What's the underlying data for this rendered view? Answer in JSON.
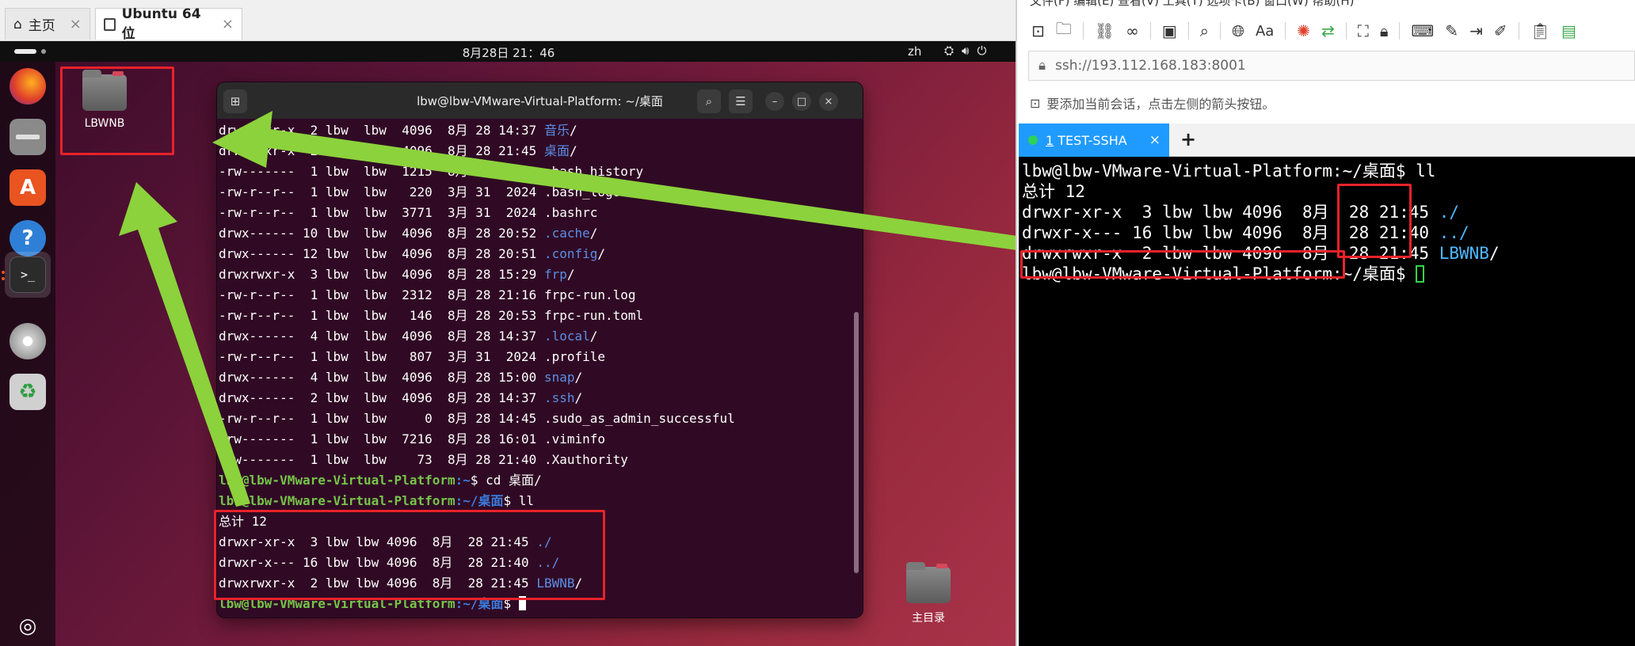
{
  "vmware": {
    "tabs": [
      {
        "label": "主页",
        "icon": "home-icon"
      },
      {
        "label": "Ubuntu 64 位",
        "icon": "vm-icon"
      }
    ]
  },
  "guest": {
    "clock": "8月28日  21：46",
    "lang": "zh",
    "desktop_icons": [
      {
        "label": "LBWNB"
      },
      {
        "label": "主目录"
      }
    ],
    "dock": [
      "firefox-icon",
      "files-icon",
      "app-center-icon",
      "help-icon",
      "terminal-icon",
      "dvd-icon",
      "trash-icon",
      "ubuntu-logo-icon"
    ]
  },
  "terminal": {
    "title": "lbw@lbw-VMware-Virtual-Platform: ~/桌面",
    "lines": [
      {
        "text": "drwxr-xr-x  2 lbw  lbw  4096  8月 28 14:37 ",
        "name": "音乐",
        "suffix": "/",
        "kind": "dir"
      },
      {
        "text": "drwxr-xr-x  2 lbw  lbw  4096  8月 28 21:45 ",
        "name": "桌面",
        "suffix": "/",
        "kind": "dir"
      },
      {
        "text": "-rw-------  1 lbw  lbw  1215  8月 28 20:51 ",
        "name": ".bash_history",
        "suffix": "",
        "kind": "file"
      },
      {
        "text": "-rw-r--r--  1 lbw  lbw   220  3月 31  2024 ",
        "name": ".bash_logout",
        "suffix": "",
        "kind": "file"
      },
      {
        "text": "-rw-r--r--  1 lbw  lbw  3771  3月 31  2024 ",
        "name": ".bashrc",
        "suffix": "",
        "kind": "file"
      },
      {
        "text": "drwx------ 10 lbw  lbw  4096  8月 28 20:52 ",
        "name": ".cache",
        "suffix": "/",
        "kind": "dir"
      },
      {
        "text": "drwx------ 12 lbw  lbw  4096  8月 28 20:51 ",
        "name": ".config",
        "suffix": "/",
        "kind": "dir"
      },
      {
        "text": "drwxrwxr-x  3 lbw  lbw  4096  8月 28 15:29 ",
        "name": "frp",
        "suffix": "/",
        "kind": "dir"
      },
      {
        "text": "-rw-r--r--  1 lbw  lbw  2312  8月 28 21:16 ",
        "name": "frpc-run.log",
        "suffix": "",
        "kind": "file"
      },
      {
        "text": "-rw-r--r--  1 lbw  lbw   146  8月 28 20:53 ",
        "name": "frpc-run.toml",
        "suffix": "",
        "kind": "file"
      },
      {
        "text": "drwx------  4 lbw  lbw  4096  8月 28 14:37 ",
        "name": ".local",
        "suffix": "/",
        "kind": "dir"
      },
      {
        "text": "-rw-r--r--  1 lbw  lbw   807  3月 31  2024 ",
        "name": ".profile",
        "suffix": "",
        "kind": "file"
      },
      {
        "text": "drwx------  4 lbw  lbw  4096  8月 28 15:00 ",
        "name": "snap",
        "suffix": "/",
        "kind": "dir"
      },
      {
        "text": "drwx------  2 lbw  lbw  4096  8月 28 14:37 ",
        "name": ".ssh",
        "suffix": "/",
        "kind": "dir"
      },
      {
        "text": "-rw-r--r--  1 lbw  lbw     0  8月 28 14:45 ",
        "name": ".sudo_as_admin_successful",
        "suffix": "",
        "kind": "file"
      },
      {
        "text": "-rw-------  1 lbw  lbw  7216  8月 28 16:01 ",
        "name": ".viminfo",
        "suffix": "",
        "kind": "file"
      },
      {
        "text": "-rw-------  1 lbw  lbw    73  8月 28 21:40 ",
        "name": ".Xauthority",
        "suffix": "",
        "kind": "file"
      },
      {
        "user": "lbw@lbw-VMware-Virtual-Platform",
        "path": ":~",
        "cmd": "$ cd 桌面/",
        "kind": "prompt"
      },
      {
        "user": "lbw@lbw-VMware-Virtual-Platform",
        "path": ":~/桌面",
        "cmd": "$ ll",
        "kind": "prompt"
      },
      {
        "text": "总计 12",
        "name": "",
        "suffix": "",
        "kind": "file"
      },
      {
        "text": "drwxr-xr-x  3 lbw lbw 4096  8月  28 21:45 ",
        "name": "./",
        "suffix": "",
        "kind": "dir"
      },
      {
        "text": "drwxr-x--- 16 lbw lbw 4096  8月  28 21:40 ",
        "name": "../",
        "suffix": "",
        "kind": "dir"
      },
      {
        "text": "drwxrwxr-x  2 lbw lbw 4096  8月  28 21:45 ",
        "name": "LBWNB",
        "suffix": "/",
        "kind": "dir"
      },
      {
        "user": "lbw@lbw-VMware-Virtual-Platform",
        "path": ":~/桌面",
        "cmd": "$ ",
        "kind": "prompt-cursor"
      }
    ]
  },
  "ssh_tool": {
    "menu": "文件(F)  编辑(E)  查看(V)  工具(T)  选项卡(B)  窗口(W)  帮助(H)",
    "address": "ssh://193.112.168.183:8001",
    "hint": "要添加当前会话，点击左侧的箭头按钮。",
    "tab": {
      "number": "1",
      "label": "TEST-SSHA"
    },
    "add_tab": "+",
    "terminal_lines": [
      {
        "text": "lbw@lbw-VMware-Virtual-Platform:~/桌面$ ll",
        "dir": "",
        "after": ""
      },
      {
        "text": "总计 12",
        "dir": "",
        "after": ""
      },
      {
        "text": "drwxr-xr-x  3 lbw lbw 4096  8月  28 21:45 ",
        "dir": "./",
        "after": ""
      },
      {
        "text": "drwxr-x--- 16 lbw lbw 4096  8月  28 21:40 ",
        "dir": "../",
        "after": ""
      },
      {
        "text": "drwxrwxr-x  2 lbw lbw 4096  8月  28 21:45 ",
        "dir": "LBWNB",
        "after": "/"
      },
      {
        "text": "lbw@lbw-VMware-Virtual-Platform:~/桌面$ ",
        "dir": "",
        "after": "",
        "cursor": true
      }
    ]
  },
  "colors": {
    "highlight": "#e8222a",
    "arrow": "#8cd23c",
    "ubuntu_terminal_bg": "#300a24",
    "ssh_tab_active": "#1f9bff",
    "ssh_dir": "#4fb8ff"
  }
}
